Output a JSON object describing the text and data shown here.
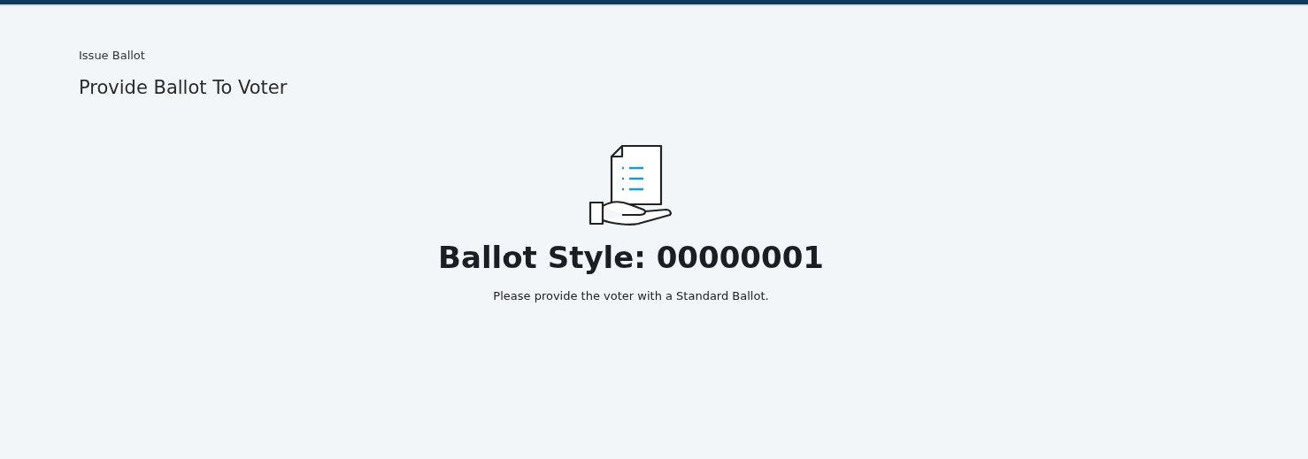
{
  "breadcrumb": "Issue Ballot",
  "page_title": "Provide Ballot To Voter",
  "ballot_style": {
    "heading": "Ballot Style: 00000001",
    "instruction": "Please provide the voter with a Standard Ballot."
  }
}
